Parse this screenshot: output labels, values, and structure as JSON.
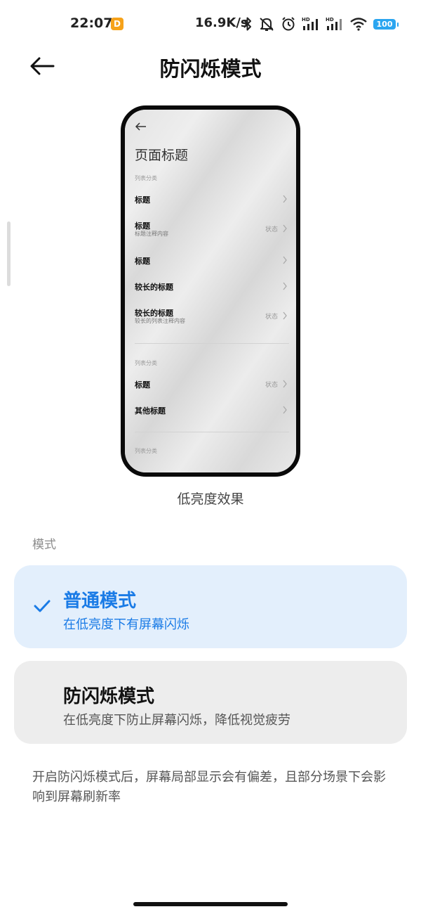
{
  "status_bar": {
    "time": "22:07",
    "badge": "D",
    "net_speed": "16.9K/s",
    "icons": [
      "bluetooth-icon",
      "mute-icon",
      "alarm-icon",
      "signal-hd-icon",
      "signal-hd-icon",
      "wifi-icon",
      "battery-icon"
    ],
    "hd_label": "HD",
    "battery": "100",
    "battery_color": "#2aa5f0"
  },
  "header": {
    "back_icon": "arrow-left-icon",
    "title": "防闪烁模式"
  },
  "preview": {
    "page_title": "页面标题",
    "sections": [
      {
        "label": "列表分类",
        "items": [
          {
            "title": "标题",
            "subtitle": "",
            "status": ""
          },
          {
            "title": "标题",
            "subtitle": "标题注释内容",
            "status": "状态"
          },
          {
            "title": "标题",
            "subtitle": "",
            "status": ""
          },
          {
            "title": "较长的标题",
            "subtitle": "",
            "status": ""
          },
          {
            "title": "较长的标题",
            "subtitle": "较长的列表注释内容",
            "status": "状态"
          }
        ]
      },
      {
        "label": "列表分类",
        "items": [
          {
            "title": "标题",
            "subtitle": "",
            "status": "状态"
          },
          {
            "title": "其他标题",
            "subtitle": "",
            "status": ""
          }
        ]
      },
      {
        "label": "列表分类",
        "items": []
      }
    ],
    "caption": "低亮度效果"
  },
  "mode_section": {
    "label": "模式",
    "options": [
      {
        "title": "普通模式",
        "description": "在低亮度下有屏幕闪烁",
        "selected": true
      },
      {
        "title": "防闪烁模式",
        "description": "在低亮度下防止屏幕闪烁，降低视觉疲劳",
        "selected": false
      }
    ],
    "accent_color": "#1a7be6",
    "selected_bg": "#e3effc"
  },
  "footnote": "开启防闪烁模式后，屏幕局部显示会有偏差，且部分场景下会影响到屏幕刷新率"
}
